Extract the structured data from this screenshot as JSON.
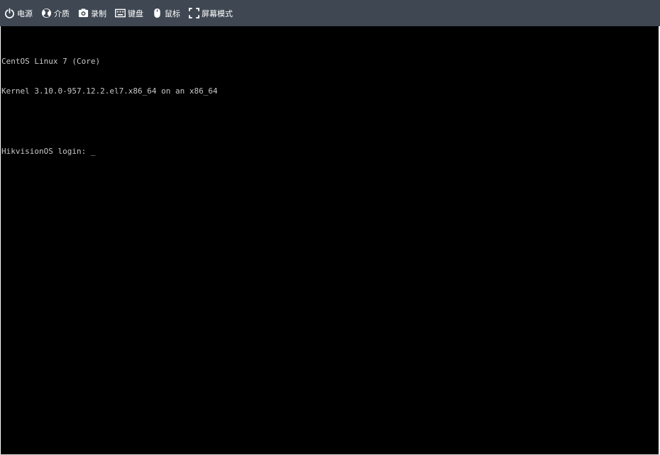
{
  "toolbar": {
    "background": "#3e4752",
    "items": [
      {
        "label": "电源",
        "icon": "power-icon"
      },
      {
        "label": "介质",
        "icon": "media-disc-icon"
      },
      {
        "label": "录制",
        "icon": "camera-icon"
      },
      {
        "label": "键盘",
        "icon": "keyboard-icon"
      },
      {
        "label": "鼠标",
        "icon": "mouse-icon"
      },
      {
        "label": "屏幕模式",
        "icon": "fullscreen-icon"
      }
    ]
  },
  "console": {
    "background": "#000000",
    "text_color": "#c9c9c9",
    "lines": [
      "CentOS Linux 7 (Core)",
      "Kernel 3.10.0-957.12.2.el7.x86_64 on an x86_64"
    ],
    "prompt": "HikvisionOS login: ",
    "cursor": "_"
  }
}
